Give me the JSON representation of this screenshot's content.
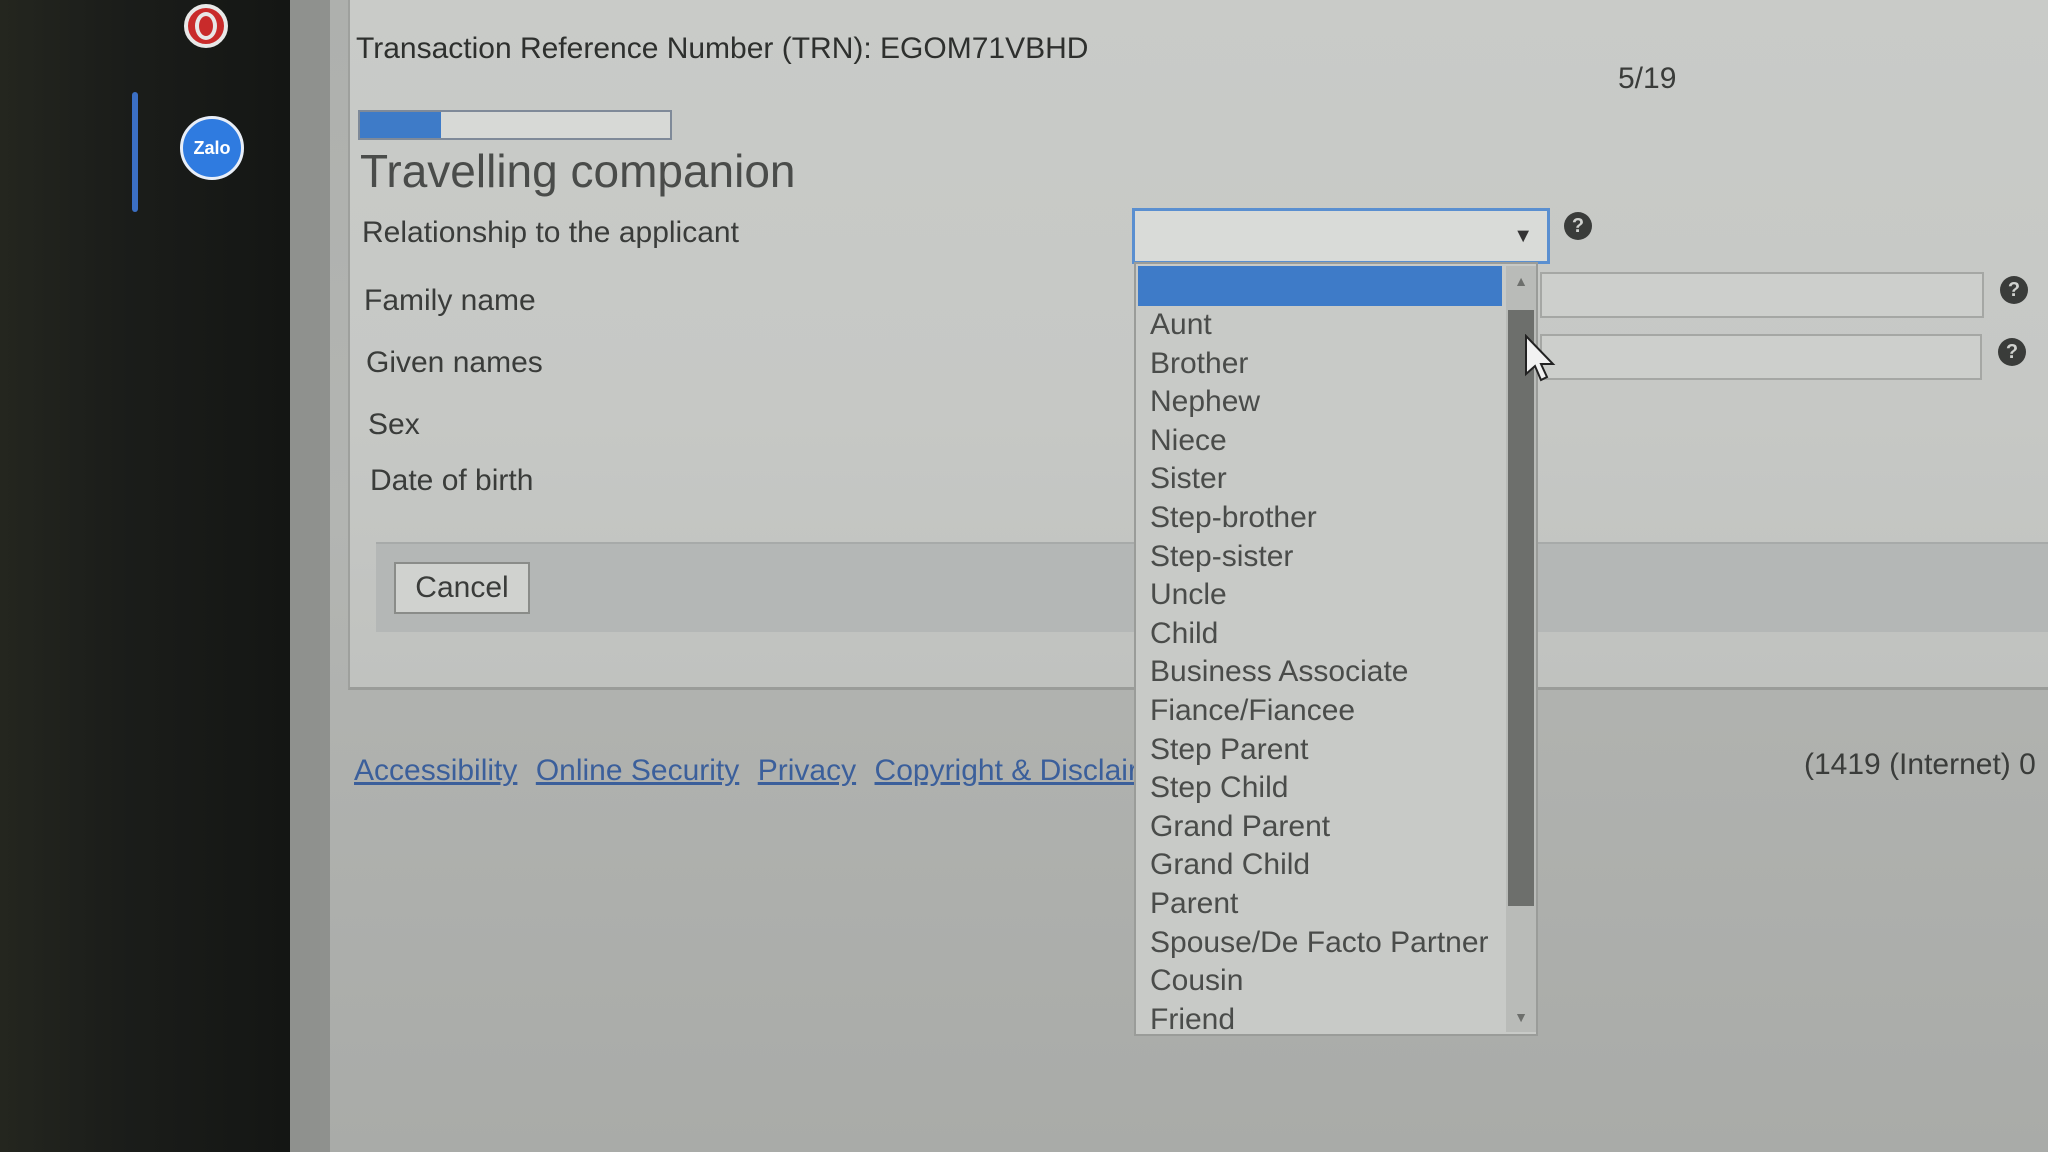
{
  "taskbar": {
    "opera_icon": "opera-browser-icon",
    "zalo_icon_label": "Zalo"
  },
  "header": {
    "trn": "Transaction Reference Number (TRN): EGOM71VBHD",
    "page_count": "5/19"
  },
  "progress": {
    "value_fraction": 0.26
  },
  "form": {
    "title": "Travelling companion",
    "fields": {
      "relationship": "Relationship to the applicant",
      "family_name": "Family name",
      "given_names": "Given names",
      "sex": "Sex",
      "date_of_birth": "Date of birth"
    },
    "relationship_value": "",
    "help_icon": "?"
  },
  "dropdown": {
    "options": [
      "Aunt",
      "Brother",
      "Nephew",
      "Niece",
      "Sister",
      "Step-brother",
      "Step-sister",
      "Uncle",
      "Child",
      "Business Associate",
      "Fiance/Fiancee",
      "Step Parent",
      "Step Child",
      "Grand Parent",
      "Grand Child",
      "Parent",
      "Spouse/De Facto Partner",
      "Cousin",
      "Friend"
    ]
  },
  "buttons": {
    "cancel": "Cancel"
  },
  "footer": {
    "links": [
      "Accessibility",
      "Online Security",
      "Privacy",
      "Copyright & Disclair"
    ],
    "phone": "(1419 (Internet) 0"
  },
  "colors": {
    "accent": "#3e7bc8",
    "link": "#3b5f9b"
  }
}
